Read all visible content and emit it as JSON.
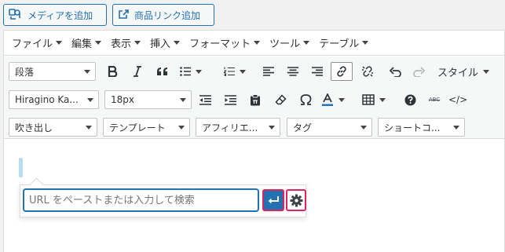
{
  "top_buttons": {
    "add_media": "メディアを追加",
    "add_product_link": "商品リンク追加"
  },
  "menubar": [
    {
      "label": "ファイル"
    },
    {
      "label": "編集"
    },
    {
      "label": "表示"
    },
    {
      "label": "挿入"
    },
    {
      "label": "フォーマット"
    },
    {
      "label": "ツール"
    },
    {
      "label": "テーブル"
    }
  ],
  "toolbar": {
    "format_select": "段落",
    "styles_label": "スタイル",
    "font_family_select": "Hiragino Ka...",
    "font_size_select": "18px",
    "row3_selects": [
      "吹き出し",
      "テンプレート",
      "アフィリエ...",
      "タグ",
      "ショートコ..."
    ],
    "strikethrough_label": "ABC",
    "code_label": "</>"
  },
  "link_popup": {
    "placeholder": "URL をペーストまたは入力して検索",
    "value": ""
  },
  "colors": {
    "accent": "#2271b1",
    "highlight_border": "#e0245e"
  }
}
